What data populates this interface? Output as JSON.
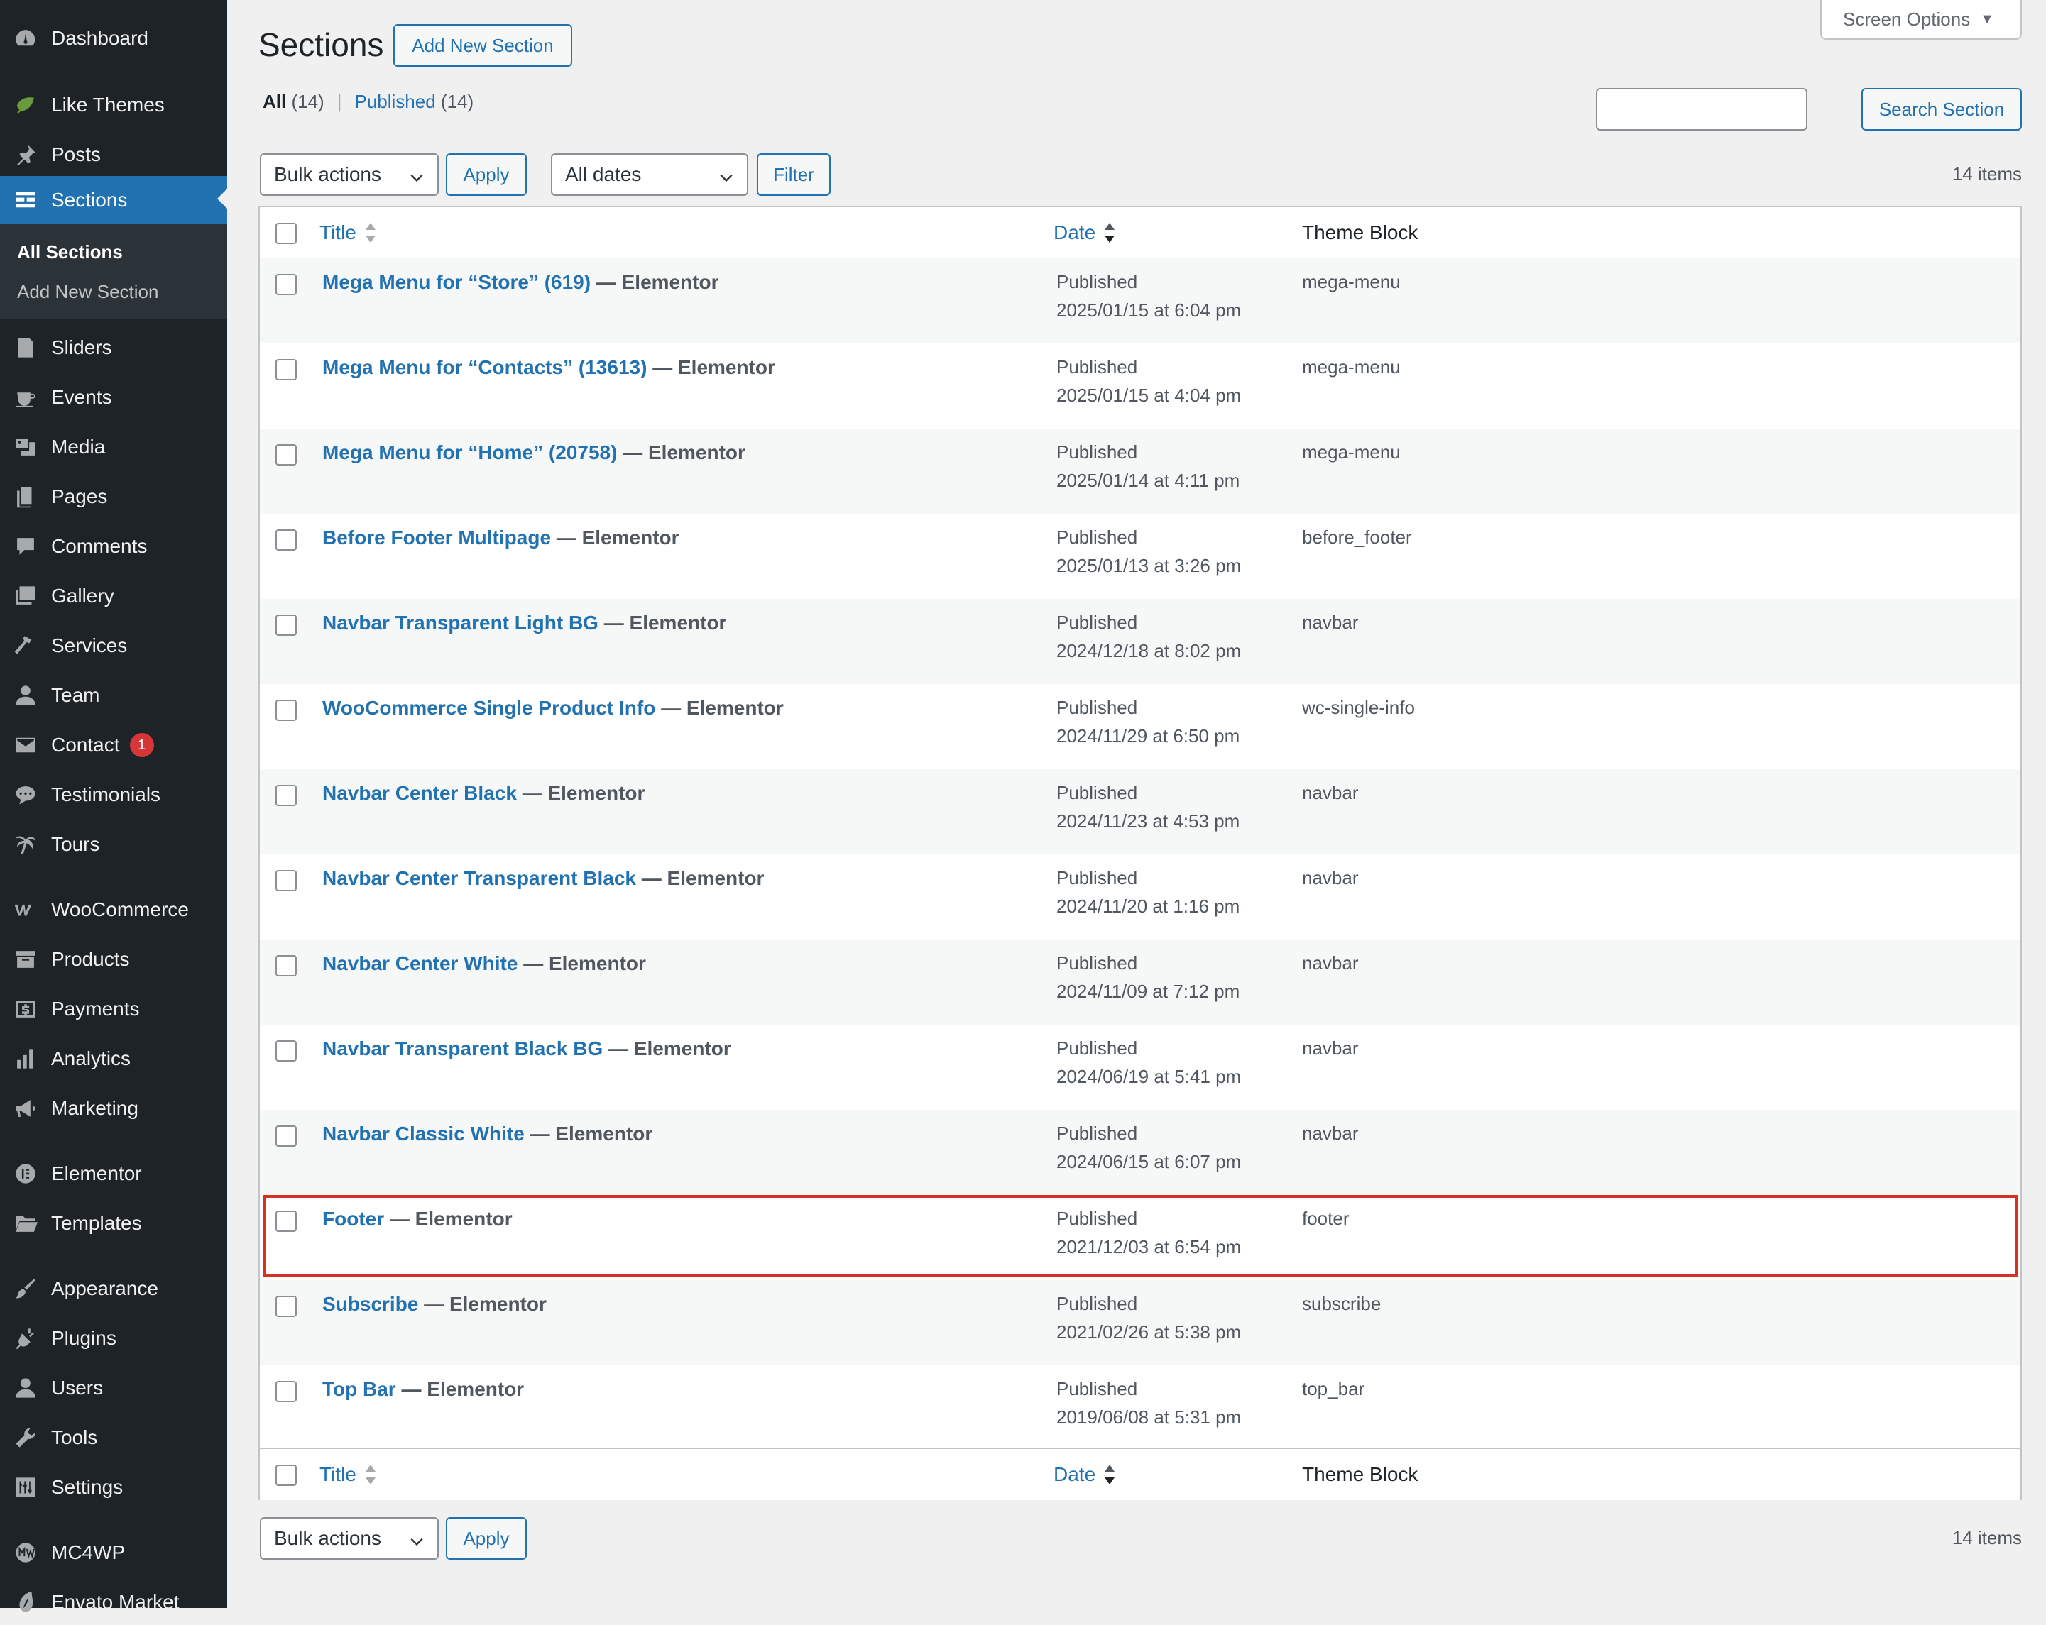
{
  "sidebar": {
    "items": [
      {
        "label": "Dashboard",
        "icon": "dashboard-icon",
        "name": "sidebar-item-dashboard"
      },
      {
        "label": "Like Themes",
        "icon": "leaf-icon",
        "name": "sidebar-item-like-themes"
      },
      {
        "label": "Posts",
        "icon": "pushpin-icon",
        "name": "sidebar-item-posts"
      },
      {
        "label": "Sections",
        "icon": "sections-icon",
        "name": "sidebar-item-sections"
      },
      {
        "label": "Sliders",
        "icon": "slides-icon",
        "name": "sidebar-item-sliders"
      },
      {
        "label": "Events",
        "icon": "coffee-icon",
        "name": "sidebar-item-events"
      },
      {
        "label": "Media",
        "icon": "media-icon",
        "name": "sidebar-item-media"
      },
      {
        "label": "Pages",
        "icon": "pages-icon",
        "name": "sidebar-item-pages"
      },
      {
        "label": "Comments",
        "icon": "comment-icon",
        "name": "sidebar-item-comments"
      },
      {
        "label": "Gallery",
        "icon": "gallery-icon",
        "name": "sidebar-item-gallery"
      },
      {
        "label": "Services",
        "icon": "hammer-icon",
        "name": "sidebar-item-services"
      },
      {
        "label": "Team",
        "icon": "person-icon",
        "name": "sidebar-item-team"
      },
      {
        "label": "Contact",
        "icon": "envelope-icon",
        "name": "sidebar-item-contact",
        "badge": "1"
      },
      {
        "label": "Testimonials",
        "icon": "speech-bubble-icon",
        "name": "sidebar-item-testimonials"
      },
      {
        "label": "Tours",
        "icon": "palm-tree-icon",
        "name": "sidebar-item-tours"
      },
      {
        "label": "WooCommerce",
        "icon": "woocommerce-icon",
        "name": "sidebar-item-woocommerce"
      },
      {
        "label": "Products",
        "icon": "archive-box-icon",
        "name": "sidebar-item-products"
      },
      {
        "label": "Payments",
        "icon": "dollar-icon",
        "name": "sidebar-item-payments"
      },
      {
        "label": "Analytics",
        "icon": "bar-chart-icon",
        "name": "sidebar-item-analytics"
      },
      {
        "label": "Marketing",
        "icon": "megaphone-icon",
        "name": "sidebar-item-marketing"
      },
      {
        "label": "Elementor",
        "icon": "elementor-icon",
        "name": "sidebar-item-elementor"
      },
      {
        "label": "Templates",
        "icon": "folder-icon",
        "name": "sidebar-item-templates"
      },
      {
        "label": "Appearance",
        "icon": "paintbrush-icon",
        "name": "sidebar-item-appearance"
      },
      {
        "label": "Plugins",
        "icon": "plug-icon",
        "name": "sidebar-item-plugins"
      },
      {
        "label": "Users",
        "icon": "users-icon",
        "name": "sidebar-item-users"
      },
      {
        "label": "Tools",
        "icon": "wrench-icon",
        "name": "sidebar-item-tools"
      },
      {
        "label": "Settings",
        "icon": "settings-sliders-icon",
        "name": "sidebar-item-settings"
      },
      {
        "label": "MC4WP",
        "icon": "mc4wp-icon",
        "name": "sidebar-item-mc4wp"
      },
      {
        "label": "Envato Market",
        "icon": "envato-leaf-icon",
        "name": "sidebar-item-envato-market"
      }
    ],
    "submenu": {
      "all_sections": "All Sections",
      "add_new_section": "Add New Section"
    }
  },
  "header": {
    "title": "Sections",
    "add_new_button": "Add New Section",
    "screen_options": "Screen Options"
  },
  "filters": {
    "all_label": "All",
    "all_count": "(14)",
    "separator": "|",
    "published_label": "Published",
    "published_count": "(14)"
  },
  "search": {
    "value": "",
    "button": "Search Section"
  },
  "tablenav": {
    "bulk_actions": "Bulk actions",
    "apply": "Apply",
    "all_dates": "All dates",
    "filter": "Filter",
    "items_count": "14 items"
  },
  "table": {
    "columns": {
      "title": "Title",
      "date": "Date",
      "theme_block": "Theme Block"
    },
    "rows": [
      {
        "title": "Mega Menu for “Store” (619)",
        "suffix": "— Elementor",
        "status": "Published",
        "date": "2025/01/15 at 6:04 pm",
        "block": "mega-menu"
      },
      {
        "title": "Mega Menu for “Contacts” (13613)",
        "suffix": "— Elementor",
        "status": "Published",
        "date": "2025/01/15 at 4:04 pm",
        "block": "mega-menu"
      },
      {
        "title": "Mega Menu for “Home” (20758)",
        "suffix": "— Elementor",
        "status": "Published",
        "date": "2025/01/14 at 4:11 pm",
        "block": "mega-menu"
      },
      {
        "title": "Before Footer Multipage",
        "suffix": "— Elementor",
        "status": "Published",
        "date": "2025/01/13 at 3:26 pm",
        "block": "before_footer"
      },
      {
        "title": "Navbar Transparent Light BG",
        "suffix": "— Elementor",
        "status": "Published",
        "date": "2024/12/18 at 8:02 pm",
        "block": "navbar"
      },
      {
        "title": "WooCommerce Single Product Info",
        "suffix": "— Elementor",
        "status": "Published",
        "date": "2024/11/29 at 6:50 pm",
        "block": "wc-single-info"
      },
      {
        "title": "Navbar Center Black",
        "suffix": "— Elementor",
        "status": "Published",
        "date": "2024/11/23 at 4:53 pm",
        "block": "navbar"
      },
      {
        "title": "Navbar Center Transparent Black",
        "suffix": "— Elementor",
        "status": "Published",
        "date": "2024/11/20 at 1:16 pm",
        "block": "navbar"
      },
      {
        "title": "Navbar Center White",
        "suffix": "— Elementor",
        "status": "Published",
        "date": "2024/11/09 at 7:12 pm",
        "block": "navbar"
      },
      {
        "title": "Navbar Transparent Black BG",
        "suffix": "— Elementor",
        "status": "Published",
        "date": "2024/06/19 at 5:41 pm",
        "block": "navbar"
      },
      {
        "title": "Navbar Classic White",
        "suffix": "— Elementor",
        "status": "Published",
        "date": "2024/06/15 at 6:07 pm",
        "block": "navbar"
      },
      {
        "title": "Footer",
        "suffix": "— Elementor",
        "status": "Published",
        "date": "2021/12/03 at 6:54 pm",
        "block": "footer",
        "highlighted": true
      },
      {
        "title": "Subscribe",
        "suffix": "— Elementor",
        "status": "Published",
        "date": "2021/02/26 at 5:38 pm",
        "block": "subscribe"
      },
      {
        "title": "Top Bar",
        "suffix": "— Elementor",
        "status": "Published",
        "date": "2019/06/08 at 5:31 pm",
        "block": "top_bar"
      }
    ]
  },
  "colors": {
    "sidebar_bg": "#1d2327",
    "accent": "#2271b1",
    "badge": "#d63638",
    "highlight": "#d93025"
  }
}
